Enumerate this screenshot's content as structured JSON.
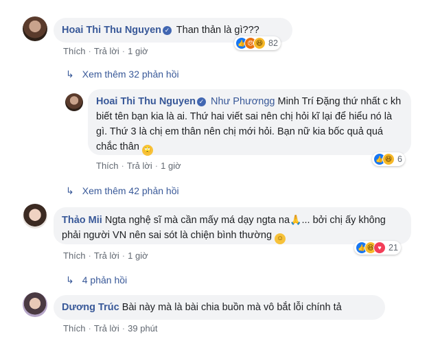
{
  "colors": {
    "link": "#385898",
    "meta": "#606770",
    "bubble": "#f2f3f5",
    "like": "#1877f2",
    "verified": "#4267b2"
  },
  "comments": [
    {
      "author": "Hoai Thi Thu Nguyen",
      "verified": true,
      "text": "Than thản là gì???",
      "reactions": {
        "icons": [
          "like-icon",
          "angry-icon",
          "haha-icon"
        ],
        "count": "82"
      },
      "actions": {
        "like": "Thích",
        "reply": "Trả lời",
        "time": "1 giờ"
      },
      "more_replies": "Xem thêm 32 phản hồi"
    },
    {
      "author": "Hoai Thi Thu Nguyen",
      "verified": true,
      "mention": "Như Phươngg",
      "text": "Minh Trí Đặng thứ nhất c kh biết tên bạn kia là ai. Thứ hai viết sai nên chị hỏi kĩ lại để hiểu nó là gì. Thứ 3 là chị em thân nên chị mới hỏi. Bạn nữ kia bốc quả quá chắc thân",
      "emoji": "eye-roll-emoji",
      "reactions": {
        "icons": [
          "like-icon",
          "haha-icon"
        ],
        "count": "6"
      },
      "actions": {
        "like": "Thích",
        "reply": "Trả lời",
        "time": "1 giờ"
      },
      "more_replies": "Xem thêm 42 phản hồi"
    },
    {
      "author": "Thảo Mii",
      "verified": false,
      "text_a": "Ngta nghệ sĩ mà cần mấy má dạy ngta na",
      "text_b": "... bởi chị ấy không phải người VN nên sai sót là chiện bình thường",
      "emoji_1": "praying-hands-emoji",
      "emoji_2": "smile-emoji",
      "reactions": {
        "icons": [
          "like-icon",
          "haha-icon",
          "love-icon"
        ],
        "count": "21"
      },
      "actions": {
        "like": "Thích",
        "reply": "Trả lời",
        "time": "1 giờ"
      },
      "more_replies": "4 phản hồi"
    },
    {
      "author": "Dương Trúc",
      "verified": false,
      "text": "Bài này mà là bài chia buồn mà vô bắt lỗi chính tả",
      "actions": {
        "like": "Thích",
        "reply": "Trả lời",
        "time": "39 phút"
      }
    }
  ]
}
